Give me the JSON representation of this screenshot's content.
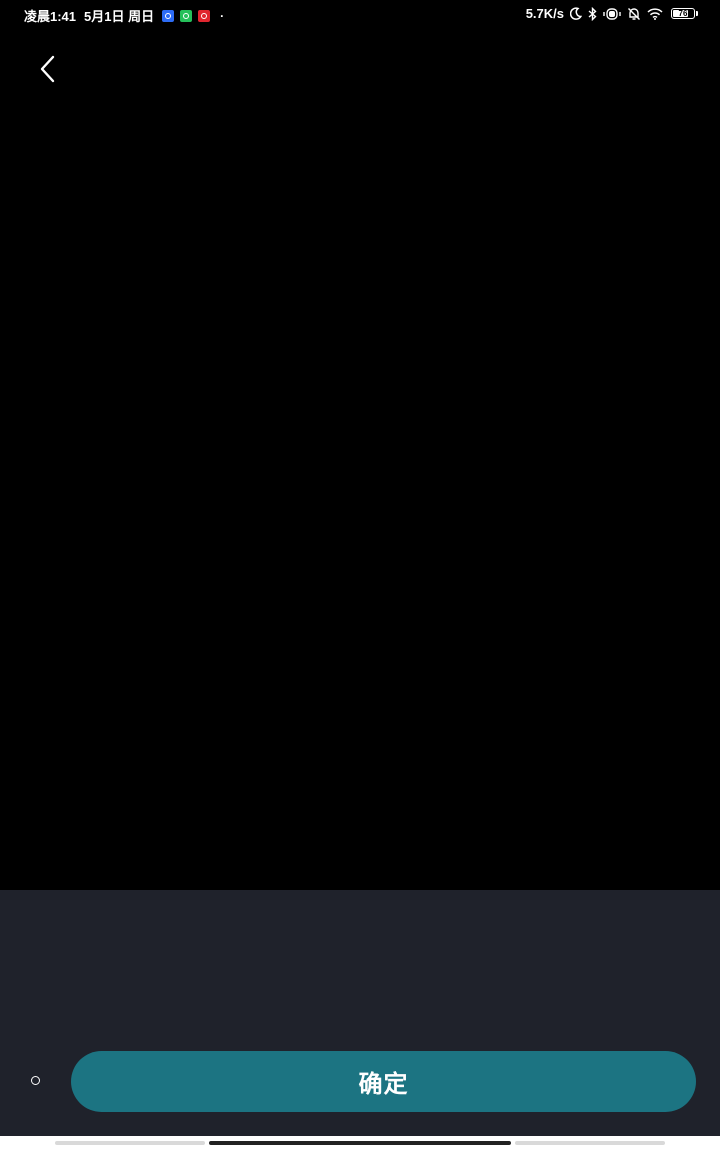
{
  "status_bar": {
    "time": "凌晨1:41",
    "date": "5月1日 周日",
    "dot": "·",
    "network_speed": "5.7K/s",
    "battery_level": "76",
    "battery_fraction": 0.76,
    "notification_icons": [
      "blue-app-icon",
      "wechat-icon",
      "red-app-icon"
    ],
    "system_icons": [
      "moon-icon",
      "bluetooth-icon",
      "vibrate-icon",
      "mute-bell-icon",
      "wifi-icon",
      "battery-icon"
    ]
  },
  "header": {
    "back_icon": "chevron-left-icon"
  },
  "bottom_panel": {
    "confirm_label": "确定",
    "button_color": "#1c7482",
    "panel_color": "#1f222b"
  }
}
